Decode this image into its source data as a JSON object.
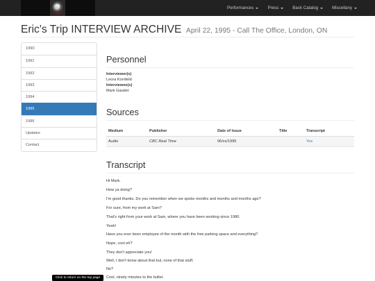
{
  "nav": {
    "logo_alt": "logo",
    "items": [
      {
        "label": "Performances"
      },
      {
        "label": "Press"
      },
      {
        "label": "Back Catalog"
      },
      {
        "label": "Miscellany"
      }
    ]
  },
  "header": {
    "title": "Eric's Trip INTERVIEW ARCHIVE",
    "subtitle": "April 22, 1995 - Call The Office, London, ON"
  },
  "sidebar": {
    "items": [
      {
        "label": "1990"
      },
      {
        "label": "1991"
      },
      {
        "label": "1992"
      },
      {
        "label": "1993"
      },
      {
        "label": "1994"
      },
      {
        "label": "1995"
      },
      {
        "label": "1996"
      },
      {
        "label": "Updates"
      },
      {
        "label": "Contact"
      }
    ],
    "active_index": 5
  },
  "personnel": {
    "heading": "Personnel",
    "interviewer_label": "Interviewer(s)",
    "interviewer": "Leora Kornfeld",
    "interviewee_label": "Interviewee(s)",
    "interviewee": "Mark Gaudet"
  },
  "sources": {
    "heading": "Sources",
    "columns": [
      "Medium",
      "Publisher",
      "Date of Issue",
      "Title",
      "Transcript"
    ],
    "rows": [
      {
        "medium": "Audio",
        "publisher": "CBC Real Time",
        "date": "06/xx/1995",
        "title": "",
        "transcript": "Yes"
      }
    ]
  },
  "transcript": {
    "heading": "Transcript",
    "lines": [
      "Hi Mark.",
      "How ya doing?",
      "I'm good thanks. Do you remember when we spoke months and months and months ago?",
      "For sure, from my work at Sam?",
      "That's right from your work at Sam, where you have been working since 1980.",
      "Yeah!",
      "Have you ever been employee of the month with the free parking space and everything?",
      "Nope, cool eh?",
      "They don't appreciate you!",
      "Well, I don't know about that but, none of that stuff.",
      "No?",
      "Cool, ninety minutes to the bullet."
    ]
  },
  "tooltip": {
    "text": "Click to return on the top page"
  }
}
